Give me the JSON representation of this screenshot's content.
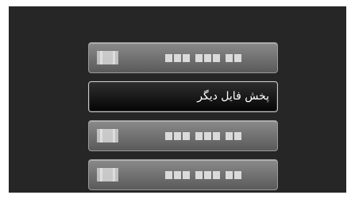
{
  "menu": {
    "items": [
      {
        "label": "",
        "selected": false
      },
      {
        "label": "پخش فایل دیگر",
        "selected": true
      },
      {
        "label": "",
        "selected": false
      },
      {
        "label": "",
        "selected": false
      }
    ]
  }
}
